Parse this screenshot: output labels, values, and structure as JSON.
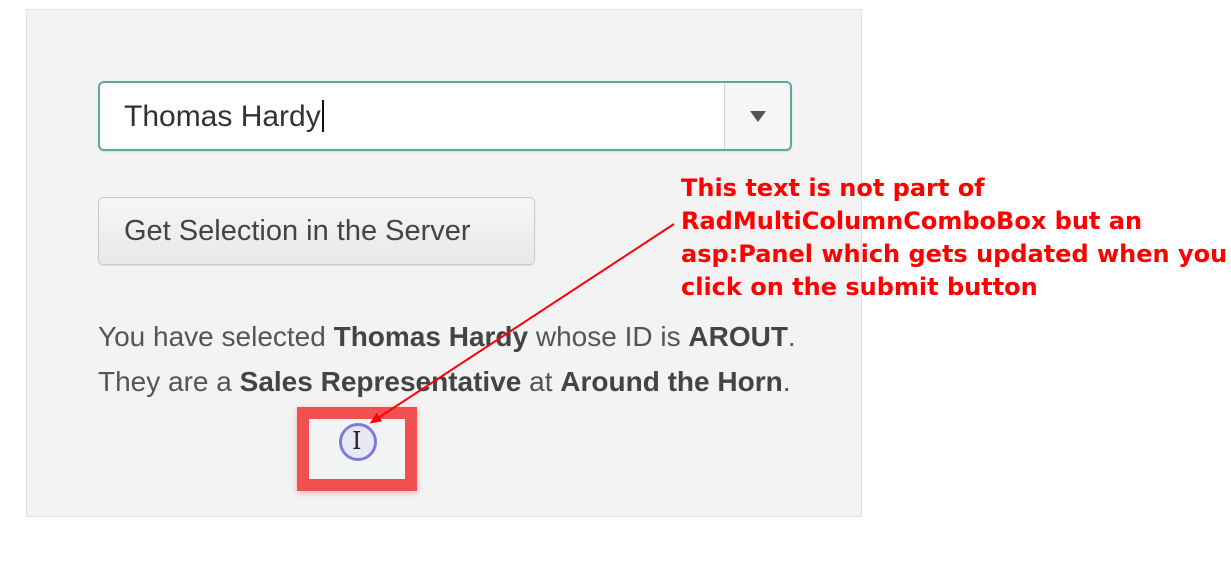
{
  "combo": {
    "value": "Thomas Hardy",
    "dropdown_icon": "triangle-down"
  },
  "submit_button": {
    "label": "Get Selection in the Server"
  },
  "result": {
    "prefix": "You have selected ",
    "name": "Thomas Hardy",
    "mid1": " whose ID is ",
    "id": "AROUT",
    "mid2": ". They are a ",
    "title": "Sales Representative",
    "mid3": " at ",
    "company": "Around the Horn",
    "suffix": "."
  },
  "annotation": {
    "color": "#ff0000",
    "lines": [
      "This text is not part of",
      "RadMultiColumnComboBox but an",
      "asp:Panel which gets updated when you",
      "click on the submit button"
    ]
  },
  "colors": {
    "panel_bg": "#f3f3f3",
    "combo_border": "#5aa89e",
    "highlight": "#f25050",
    "cursor_ring": "#7a7ae0"
  }
}
